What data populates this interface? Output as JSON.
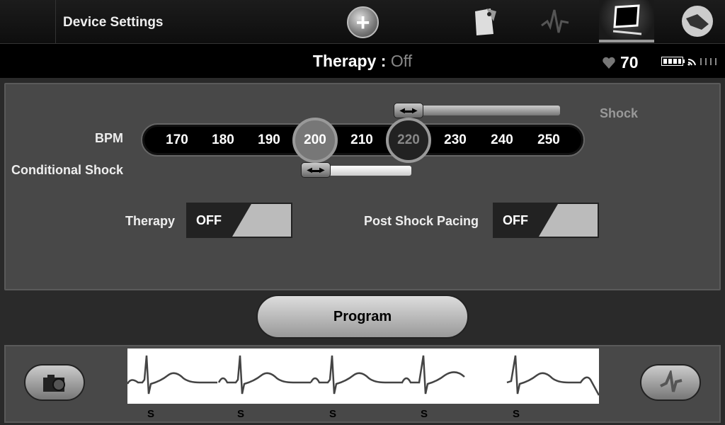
{
  "header": {
    "title": "Device Settings",
    "add_icon": "plus-circle-icon",
    "tabs": [
      {
        "icon": "document-tag-icon",
        "active": false
      },
      {
        "icon": "ecg-waveform-icon",
        "active": false
      },
      {
        "icon": "computer-monitor-icon",
        "active": true
      },
      {
        "icon": "device-wand-icon",
        "active": false
      }
    ]
  },
  "status": {
    "therapy_label": "Therapy :",
    "therapy_value": "Off",
    "heart_rate": "70",
    "heart_icon": "heart-icon",
    "battery_icon": "battery-full-icon",
    "signal_icon": "wireless-signal-icon"
  },
  "settings": {
    "bpm_label": "BPM",
    "shock_label": "Shock",
    "conditional_shock_label": "Conditional Shock",
    "bpm_ticks": [
      "170",
      "180",
      "190",
      "200",
      "210",
      "220",
      "230",
      "240",
      "250"
    ],
    "conditional_shock_bpm": "200",
    "shock_bpm": "220",
    "therapy_label": "Therapy",
    "therapy_toggle": "OFF",
    "post_shock_pacing_label": "Post Shock Pacing",
    "post_shock_pacing_toggle": "OFF"
  },
  "program_label": "Program",
  "ecg": {
    "markers": [
      "S",
      "S",
      "S",
      "S",
      "S"
    ],
    "camera_icon": "camera-icon",
    "waveform_icon": "ecg-marker-icon"
  },
  "colors": {
    "background": "#2a2a2a",
    "panel": "#484848",
    "ecg_line": "#444444"
  }
}
